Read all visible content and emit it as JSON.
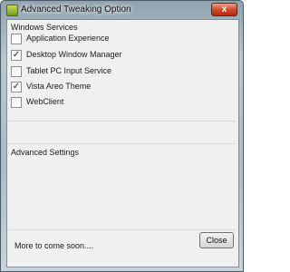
{
  "window": {
    "title": "Advanced Tweaking Option",
    "close_glyph": "x",
    "icon": "app-icon"
  },
  "services": {
    "title": "Windows Services",
    "items": [
      {
        "label": "Application Experience",
        "checked": false
      },
      {
        "label": "Desktop Window Manager",
        "checked": true
      },
      {
        "label": "Tablet PC Input Service",
        "checked": false
      },
      {
        "label": "Vista Areo Theme",
        "checked": true
      },
      {
        "label": "WebClient",
        "checked": false
      }
    ]
  },
  "advanced": {
    "title": "Advanced Settings"
  },
  "footer": {
    "message": "More to come soon....",
    "close_label": "Close"
  },
  "colors": {
    "title_close_button": "#cf4a2c",
    "client_background": "#f0f0f0"
  }
}
